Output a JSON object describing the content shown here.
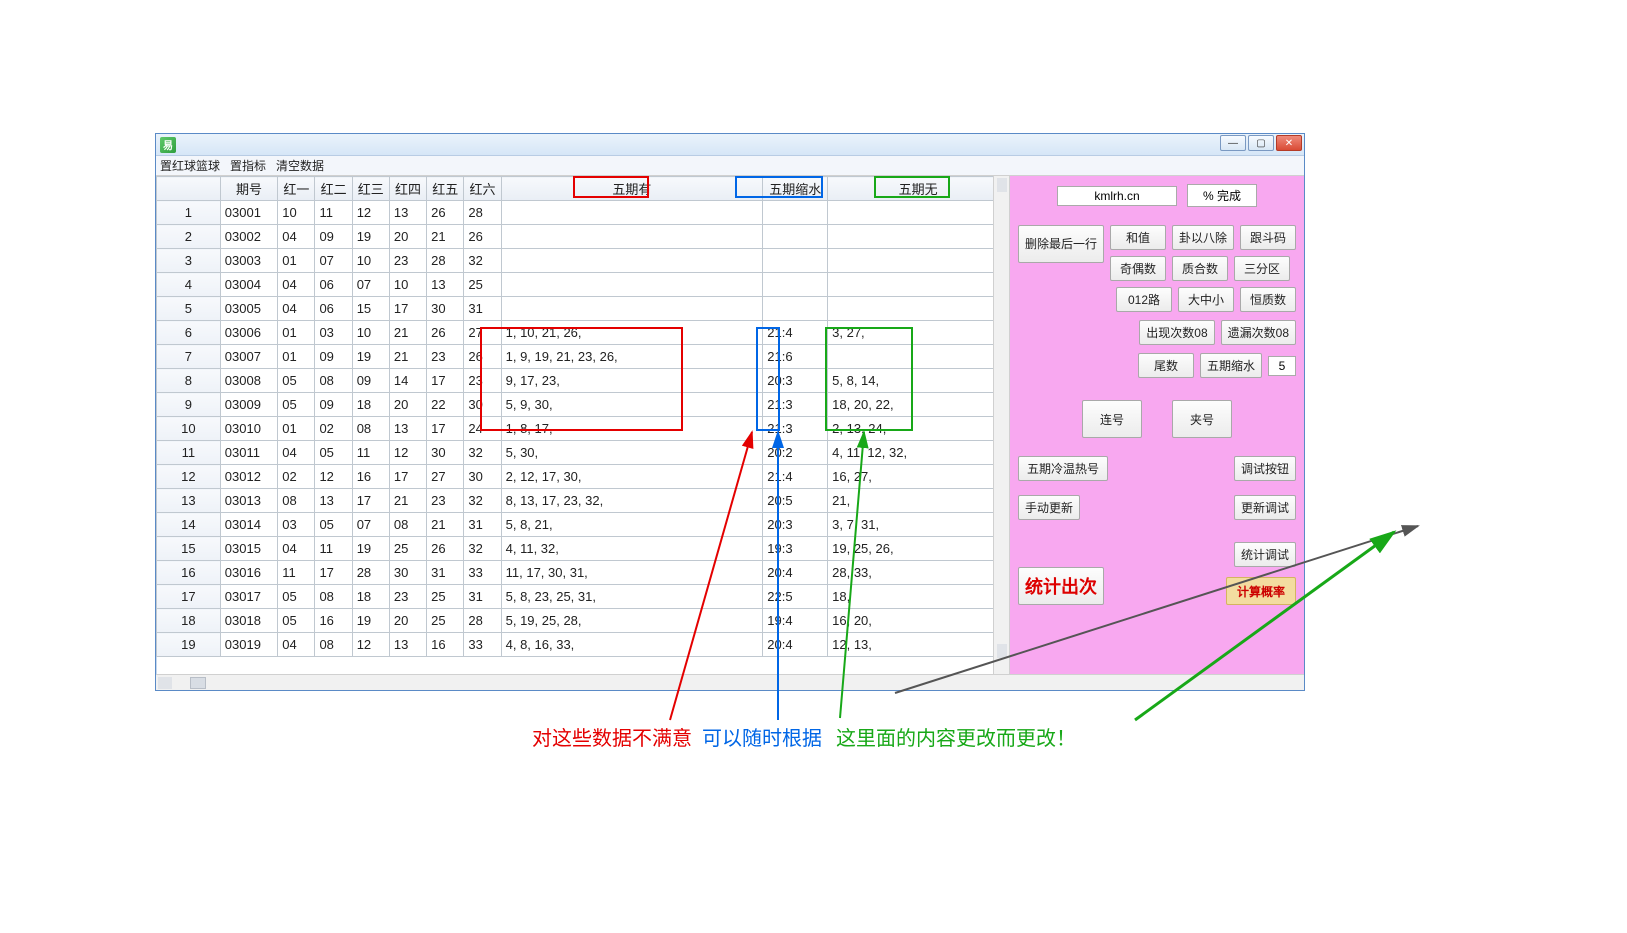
{
  "menubar": {
    "m1": "置红球篮球",
    "m2": "置指标",
    "m3": "清空数据"
  },
  "headers": {
    "rownum": "",
    "qihao": "期号",
    "r1": "红一",
    "r2": "红二",
    "r3": "红三",
    "r4": "红四",
    "r5": "红五",
    "r6": "红六",
    "wuyou": "五期有",
    "suoshui": "五期缩水",
    "wuwu": "五期无"
  },
  "rows": [
    {
      "n": "1",
      "q": "03001",
      "r": [
        "10",
        "11",
        "12",
        "13",
        "26",
        "28"
      ],
      "y": "",
      "s": "",
      "w": ""
    },
    {
      "n": "2",
      "q": "03002",
      "r": [
        "04",
        "09",
        "19",
        "20",
        "21",
        "26"
      ],
      "y": "",
      "s": "",
      "w": ""
    },
    {
      "n": "3",
      "q": "03003",
      "r": [
        "01",
        "07",
        "10",
        "23",
        "28",
        "32"
      ],
      "y": "",
      "s": "",
      "w": ""
    },
    {
      "n": "4",
      "q": "03004",
      "r": [
        "04",
        "06",
        "07",
        "10",
        "13",
        "25"
      ],
      "y": "",
      "s": "",
      "w": ""
    },
    {
      "n": "5",
      "q": "03005",
      "r": [
        "04",
        "06",
        "15",
        "17",
        "30",
        "31"
      ],
      "y": "",
      "s": "",
      "w": ""
    },
    {
      "n": "6",
      "q": "03006",
      "r": [
        "01",
        "03",
        "10",
        "21",
        "26",
        "27"
      ],
      "y": "1, 10, 21, 26,",
      "s": "21:4",
      "w": "3, 27,"
    },
    {
      "n": "7",
      "q": "03007",
      "r": [
        "01",
        "09",
        "19",
        "21",
        "23",
        "26"
      ],
      "y": "1, 9, 19, 21, 23, 26,",
      "s": "21:6",
      "w": ""
    },
    {
      "n": "8",
      "q": "03008",
      "r": [
        "05",
        "08",
        "09",
        "14",
        "17",
        "23"
      ],
      "y": "9, 17, 23,",
      "s": "20:3",
      "w": "5, 8, 14,"
    },
    {
      "n": "9",
      "q": "03009",
      "r": [
        "05",
        "09",
        "18",
        "20",
        "22",
        "30"
      ],
      "y": "5, 9, 30,",
      "s": "21:3",
      "w": "18, 20, 22,"
    },
    {
      "n": "10",
      "q": "03010",
      "r": [
        "01",
        "02",
        "08",
        "13",
        "17",
        "24"
      ],
      "y": "1, 8, 17,",
      "s": "21:3",
      "w": "2, 13, 24,"
    },
    {
      "n": "11",
      "q": "03011",
      "r": [
        "04",
        "05",
        "11",
        "12",
        "30",
        "32"
      ],
      "y": "5, 30,",
      "s": "20:2",
      "w": "4, 11, 12, 32,"
    },
    {
      "n": "12",
      "q": "03012",
      "r": [
        "02",
        "12",
        "16",
        "17",
        "27",
        "30"
      ],
      "y": "2, 12, 17, 30,",
      "s": "21:4",
      "w": "16, 27,"
    },
    {
      "n": "13",
      "q": "03013",
      "r": [
        "08",
        "13",
        "17",
        "21",
        "23",
        "32"
      ],
      "y": "8, 13, 17, 23, 32,",
      "s": "20:5",
      "w": "21,"
    },
    {
      "n": "14",
      "q": "03014",
      "r": [
        "03",
        "05",
        "07",
        "08",
        "21",
        "31"
      ],
      "y": "5, 8, 21,",
      "s": "20:3",
      "w": "3, 7, 31,"
    },
    {
      "n": "15",
      "q": "03015",
      "r": [
        "04",
        "11",
        "19",
        "25",
        "26",
        "32"
      ],
      "y": "4, 11, 32,",
      "s": "19:3",
      "w": "19, 25, 26,"
    },
    {
      "n": "16",
      "q": "03016",
      "r": [
        "11",
        "17",
        "28",
        "30",
        "31",
        "33"
      ],
      "y": "11, 17, 30, 31,",
      "s": "20:4",
      "w": "28, 33,"
    },
    {
      "n": "17",
      "q": "03017",
      "r": [
        "05",
        "08",
        "18",
        "23",
        "25",
        "31"
      ],
      "y": "5, 8, 23, 25, 31,",
      "s": "22:5",
      "w": "18,"
    },
    {
      "n": "18",
      "q": "03018",
      "r": [
        "05",
        "16",
        "19",
        "20",
        "25",
        "28"
      ],
      "y": "5, 19, 25, 28,",
      "s": "19:4",
      "w": "16, 20,"
    },
    {
      "n": "19",
      "q": "03019",
      "r": [
        "04",
        "08",
        "12",
        "13",
        "16",
        "33"
      ],
      "y": "4, 8, 16, 33,",
      "s": "20:4",
      "w": "12, 13,"
    }
  ],
  "side": {
    "site": "kmlrh.cn",
    "progress": "% 完成",
    "del_last": "删除最后一行",
    "hezhi": "和值",
    "guayibachu": "卦以八除",
    "gendouma": "跟斗码",
    "qiou": "奇偶数",
    "zhihe": "质合数",
    "sanfenqu": "三分区",
    "lu012": "012路",
    "dazhongxiao": "大中小",
    "hengzhi": "恒质数",
    "chuxian": "出现次数08",
    "yilou": "遗漏次数08",
    "weishu": "尾数",
    "wuqi_suoshui": "五期缩水",
    "suoshui_val": "5",
    "lianhao": "连号",
    "jiahao": "夹号",
    "lengwen": "五期冷温热号",
    "tiaoshi_btn": "调试按钮",
    "shoudong": "手动更新",
    "gengxin_ts": "更新调试",
    "tongji_chuci": "统计出次",
    "tongji_ts": "统计调试",
    "jisuan_gailv": "计算概率"
  },
  "annotations": {
    "left_red": "对这些数据不满意",
    "left_blue": "可以随时根据",
    "right_green": "这里面的内容更改而更改！"
  }
}
